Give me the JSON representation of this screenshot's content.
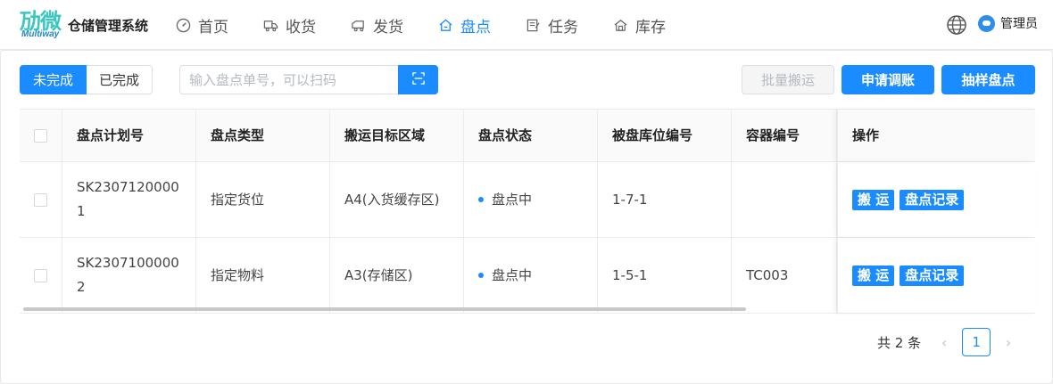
{
  "header": {
    "logo_cn": "劢微",
    "logo_en": "Multiway",
    "system_title": "仓储管理系统",
    "nav": [
      {
        "label": "首页",
        "icon": "dashboard-icon",
        "active": false
      },
      {
        "label": "收货",
        "icon": "truck-icon",
        "active": false
      },
      {
        "label": "发货",
        "icon": "shipping-icon",
        "active": false
      },
      {
        "label": "盘点",
        "icon": "home-icon",
        "active": true
      },
      {
        "label": "任务",
        "icon": "task-icon",
        "active": false
      },
      {
        "label": "库存",
        "icon": "warehouse-icon",
        "active": false
      }
    ],
    "user_name": "管理员"
  },
  "toolbar": {
    "tab_incomplete": "未完成",
    "tab_complete": "已完成",
    "search_placeholder": "输入盘点单号，可以扫码",
    "batch_move": "批量搬运",
    "apply_adjust": "申请调账",
    "sample_count": "抽样盘点"
  },
  "table": {
    "columns": [
      "盘点计划号",
      "盘点类型",
      "搬运目标区域",
      "盘点状态",
      "被盘库位编号",
      "容器编号",
      "操作"
    ],
    "rows": [
      {
        "plan_no": "SK23071200001",
        "type": "指定货位",
        "target_area": "A4(入货缓存区)",
        "status": "盘点中",
        "location": "1-7-1",
        "container": "",
        "op_move": "搬 运",
        "op_record": "盘点记录"
      },
      {
        "plan_no": "SK23071000002",
        "type": "指定物料",
        "target_area": "A3(存储区)",
        "status": "盘点中",
        "location": "1-5-1",
        "container": "TC003",
        "op_move": "搬 运",
        "op_record": "盘点记录"
      }
    ]
  },
  "pagination": {
    "total": "共 2 条",
    "current_page": "1"
  },
  "colors": {
    "primary": "#1a8cff",
    "logo_teal": "#39c7c0"
  }
}
